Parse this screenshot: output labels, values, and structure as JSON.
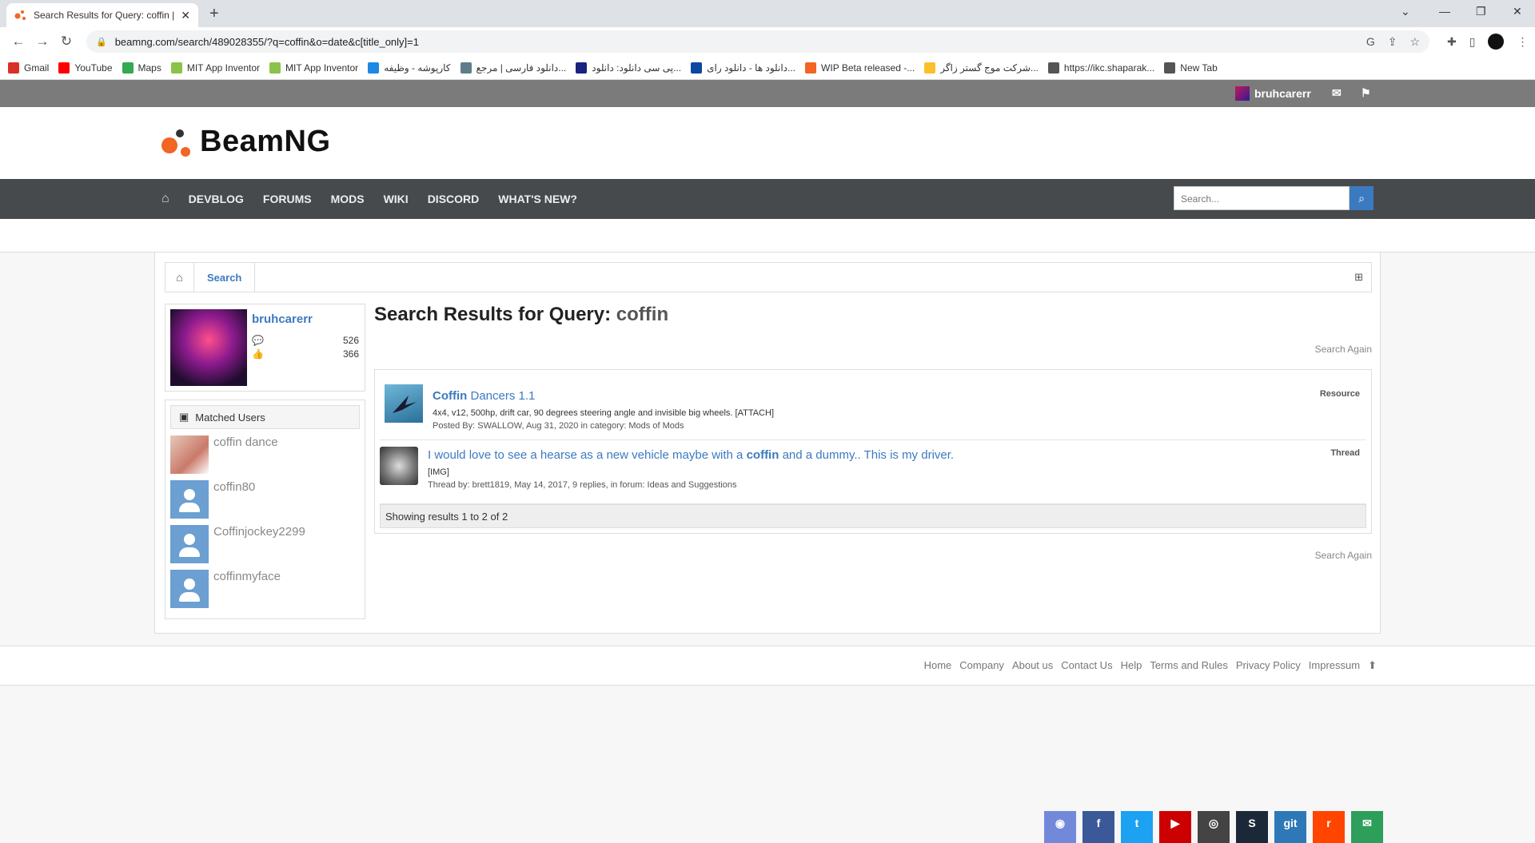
{
  "browser": {
    "tab_title": "Search Results for Query: coffin |",
    "tab_close": "✕",
    "new_tab": "+",
    "url": "beamng.com/search/489028355/?q=coffin&o=date&c[title_only]=1",
    "window_controls": [
      "⌄",
      "—",
      "❐",
      "✕"
    ]
  },
  "bookmarks": [
    {
      "label": "Gmail",
      "color": "#d93025"
    },
    {
      "label": "YouTube",
      "color": "#ff0000"
    },
    {
      "label": "Maps",
      "color": "#34a853"
    },
    {
      "label": "MIT App Inventor",
      "color": "#8bc34a"
    },
    {
      "label": "MIT App Inventor",
      "color": "#8bc34a"
    },
    {
      "label": "کارپوشه - وظیفه",
      "color": "#1e88e5"
    },
    {
      "label": "دانلود فارسی | مرجع...",
      "color": "#607d8b"
    },
    {
      "label": "پی سی دانلود: دانلود...",
      "color": "#1a237e"
    },
    {
      "label": "دانلود ها - دانلود رای...",
      "color": "#0d47a1"
    },
    {
      "label": "WIP Beta released -...",
      "color": "#f26522"
    },
    {
      "label": "شرکت موج گستر زاگر...",
      "color": "#fbc02d"
    },
    {
      "label": "https://ikc.shaparak...",
      "color": "#555555"
    },
    {
      "label": "New Tab",
      "color": "#555555"
    }
  ],
  "userbar": {
    "username": "bruhcarerr"
  },
  "site": {
    "logo": "BeamNG"
  },
  "nav": {
    "items": [
      "DEVBLOG",
      "FORUMS",
      "MODS",
      "WIKI",
      "DISCORD",
      "WHAT'S NEW?"
    ],
    "search_placeholder": "Search..."
  },
  "breadcrumb": {
    "current": "Search"
  },
  "sidebar": {
    "username": "bruhcarerr",
    "messages": "526",
    "likes": "366",
    "matched_title": "Matched Users",
    "matched_users": [
      "coffin dance",
      "coffin80",
      "Coffinjockey2299",
      "coffinmyface"
    ]
  },
  "main": {
    "title_prefix": "Search Results for Query:",
    "query": "coffin",
    "search_again": "Search Again",
    "results": [
      {
        "title_match": "Coffin",
        "title_rest": "Dancers 1.1",
        "snippet": "4x4, v12, 500hp, drift car, 90 degrees steering angle and invisible big wheels. [ATTACH]",
        "meta": "Posted By: SWALLOW, Aug 31, 2020 in category: Mods of Mods",
        "type": "Resource"
      },
      {
        "title_pre": "I would love to see a hearse as a new vehicle maybe with a",
        "title_match": "coffin",
        "title_post": "and a dummy.. This is my driver.",
        "snippet": "[IMG]",
        "meta": "Thread by: brett1819, May 14, 2017, 9 replies, in forum: Ideas and Suggestions",
        "type": "Thread"
      }
    ],
    "showing": "Showing results 1 to 2 of 2"
  },
  "footer": {
    "links": [
      "Home",
      "Company",
      "About us",
      "Contact Us",
      "Help",
      "Terms and Rules",
      "Privacy Policy",
      "Impressum"
    ]
  },
  "social": [
    {
      "name": "discord",
      "color": "#7289da",
      "glyph": "◉"
    },
    {
      "name": "facebook",
      "color": "#3b5998",
      "glyph": "f"
    },
    {
      "name": "twitter",
      "color": "#1da1f2",
      "glyph": "t"
    },
    {
      "name": "youtube",
      "color": "#cc0000",
      "glyph": "▶"
    },
    {
      "name": "instagram",
      "color": "#444444",
      "glyph": "◎"
    },
    {
      "name": "steam",
      "color": "#1b2838",
      "glyph": "S"
    },
    {
      "name": "git",
      "color": "#2e78b7",
      "glyph": "git"
    },
    {
      "name": "reddit",
      "color": "#ff4500",
      "glyph": "r"
    },
    {
      "name": "email",
      "color": "#2e9e5b",
      "glyph": "✉"
    }
  ]
}
